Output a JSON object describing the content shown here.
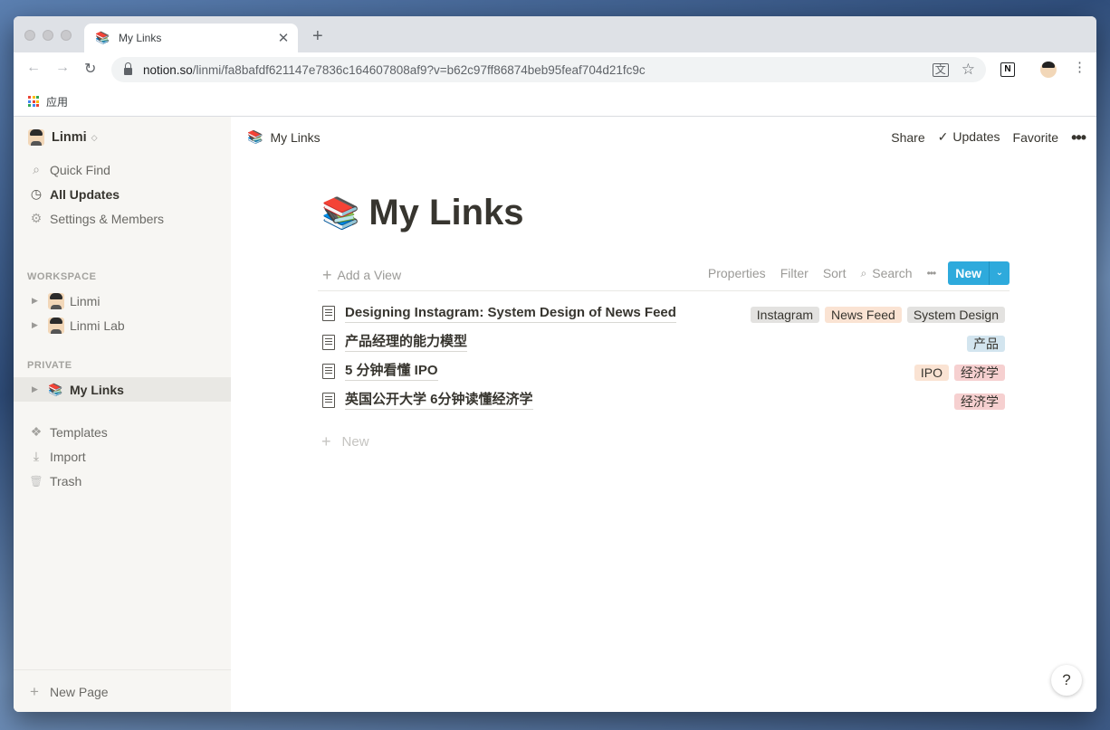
{
  "browser": {
    "tab_title": "My Links",
    "tab_icon": "📚",
    "tab_close": "✕",
    "new_tab": "+",
    "url_host": "notion.so",
    "url_path": "/linmi/fa8bafdf621147e7836c164607808af9?v=b62c97ff86874beb95feaf704d21fc9c",
    "translate_icon": "文",
    "bookmark_apps": "应用",
    "nav_back": "←",
    "nav_forward": "→",
    "nav_reload": "↻",
    "star": "☆",
    "ext_letter": "N",
    "menu": "⋮"
  },
  "sidebar": {
    "workspace_name": "Linmi",
    "workspace_caret": "◇",
    "top_items": [
      {
        "label": "Quick Find",
        "icon": "search-icon",
        "glyph": "⌕"
      },
      {
        "label": "All Updates",
        "icon": "clock-icon",
        "glyph": "◷"
      },
      {
        "label": "Settings & Members",
        "icon": "gear-icon",
        "glyph": "⚙"
      }
    ],
    "workspace_section": "WORKSPACE",
    "workspace_pages": [
      {
        "label": "Linmi"
      },
      {
        "label": "Linmi Lab"
      }
    ],
    "private_section": "PRIVATE",
    "private_pages": [
      {
        "label": "My Links",
        "icon": "📚"
      }
    ],
    "bottom_items": [
      {
        "label": "Templates",
        "icon": "templates-icon",
        "glyph": "❖"
      },
      {
        "label": "Import",
        "icon": "import-icon",
        "glyph": "⤓"
      },
      {
        "label": "Trash",
        "icon": "trash-icon",
        "glyph": "🗑"
      }
    ],
    "new_page": "New Page",
    "plus": "+",
    "tri": "▶"
  },
  "topbar": {
    "breadcrumb_icon": "📚",
    "breadcrumb": "My Links",
    "share": "Share",
    "updates": "Updates",
    "updates_check": "✓",
    "favorite": "Favorite",
    "more": "•••"
  },
  "page": {
    "icon": "📚",
    "title": "My Links"
  },
  "view_bar": {
    "add_view": "Add a View",
    "plus": "+",
    "properties": "Properties",
    "filter": "Filter",
    "sort": "Sort",
    "search_glyph": "⌕",
    "search": "Search",
    "more": "•••",
    "new": "New",
    "new_caret": "⌄"
  },
  "rows": [
    {
      "name": "Designing Instagram: System Design of News Feed",
      "tags": [
        {
          "label": "Instagram",
          "color": "#e3e2e0"
        },
        {
          "label": "News Feed",
          "color": "#fae3d3"
        },
        {
          "label": "System Design",
          "color": "#e3e2e0"
        }
      ]
    },
    {
      "name": "产品经理的能力模型",
      "tags": [
        {
          "label": "产品",
          "color": "#d3e5ef"
        }
      ]
    },
    {
      "name": "5 分钟看懂 IPO",
      "tags": [
        {
          "label": "IPO",
          "color": "#fae3d3"
        },
        {
          "label": "经济学",
          "color": "#f6d0d0"
        }
      ]
    },
    {
      "name": "英国公开大学 6分钟读懂经济学",
      "tags": [
        {
          "label": "经济学",
          "color": "#f6d0d0"
        }
      ]
    }
  ],
  "new_row": "New",
  "help": "?"
}
